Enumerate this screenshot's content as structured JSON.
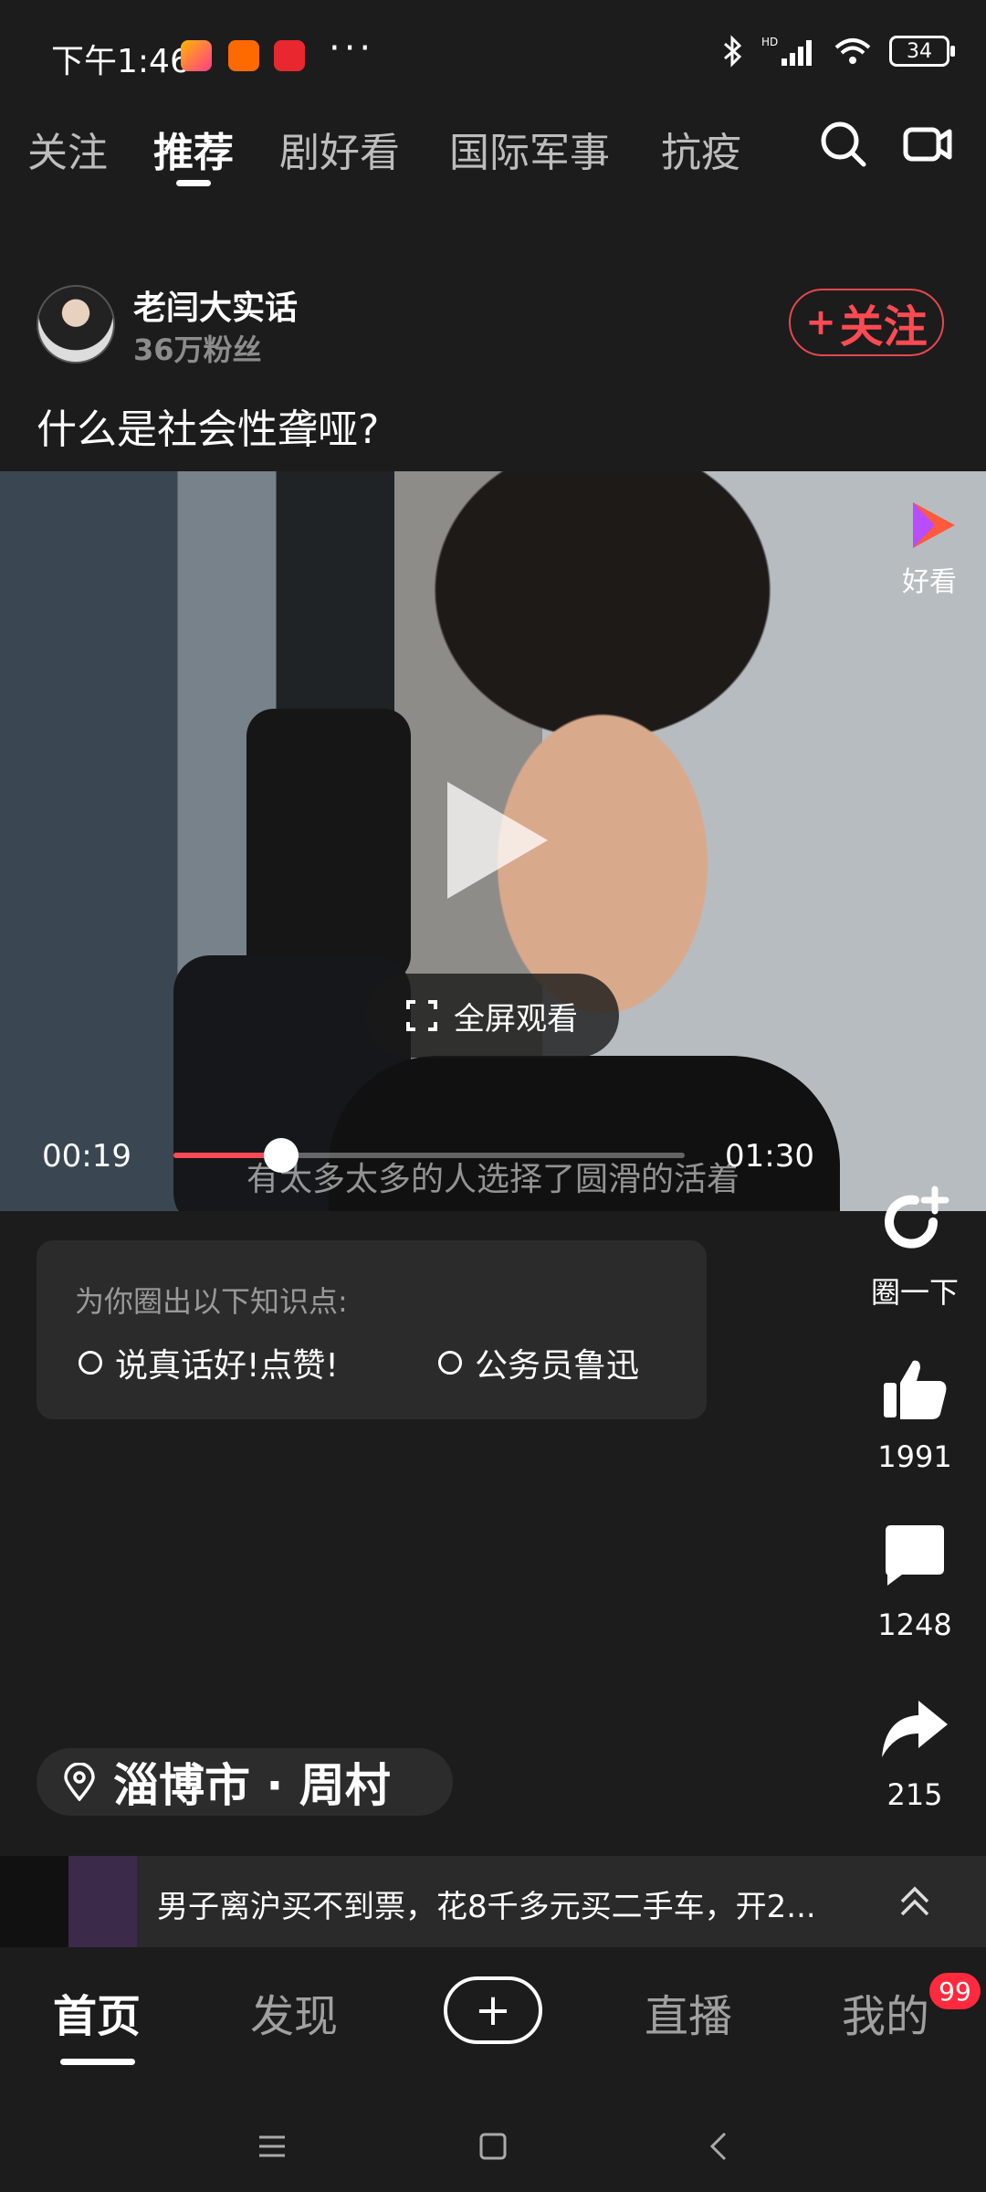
{
  "status_bar": {
    "time": "下午1:46",
    "dots": "···",
    "battery": "34"
  },
  "top_tabs": [
    {
      "label": "关注"
    },
    {
      "label": "推荐"
    },
    {
      "label": "剧好看"
    },
    {
      "label": "国际军事"
    },
    {
      "label": "抗疫"
    }
  ],
  "icons": {
    "search": "search-icon",
    "camera": "video-camera-icon"
  },
  "post": {
    "author_name": "老闫大实话",
    "fans": "36万粉丝",
    "follow_label": "关注",
    "title": "什么是社会性聋哑?"
  },
  "video": {
    "current_time": "00:19",
    "total_time": "01:30",
    "progress": 0.21,
    "subtitle": "有太多太多的人选择了圆滑的活着",
    "fullscreen_label": "全屏观看",
    "watermark": "好看"
  },
  "knowledge": {
    "title": "为你圈出以下知识点:",
    "items": [
      "说真话好!点赞!",
      "公务员鲁迅"
    ]
  },
  "actions": {
    "circle_label": "圈一下",
    "likes": "1991",
    "comments": "1248",
    "shares": "215"
  },
  "location": {
    "text": "淄博市 · 周村"
  },
  "news": {
    "text": "男子离沪买不到票，花8千多元买二手车，开2..."
  },
  "bottom_nav": {
    "home": "首页",
    "discover": "发现",
    "live": "直播",
    "mine": "我的",
    "badge": "99"
  },
  "colors": {
    "accent": "#ff4a53",
    "background": "#1c1c1c",
    "badge": "#ff2a3d"
  }
}
